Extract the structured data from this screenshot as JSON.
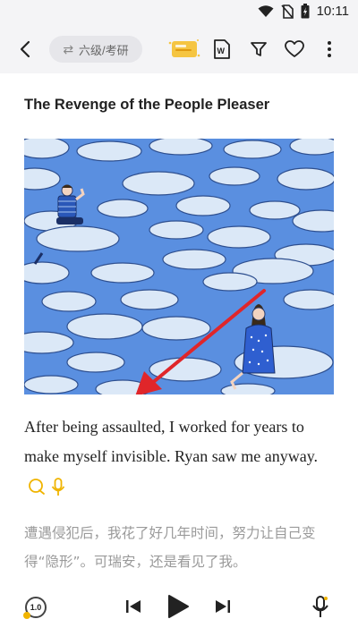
{
  "status_bar": {
    "time": "10:11"
  },
  "toolbar": {
    "level_label": "六级/考研",
    "swap_symbol": "⇄"
  },
  "article": {
    "title": "The Revenge of the People Pleaser",
    "english": "After being assaulted, I worked for years to make myself invisible. Ryan saw me anyway.",
    "chinese": "遭遇侵犯后，我花了好几年时间，努力让自己变得“隐形”。可瑞安，还是看见了我。"
  },
  "player": {
    "speed": "1.0"
  },
  "colors": {
    "accent_yellow": "#f0b400",
    "illustration_blue": "#5a8fe0",
    "arrow_red": "#e0262a"
  }
}
